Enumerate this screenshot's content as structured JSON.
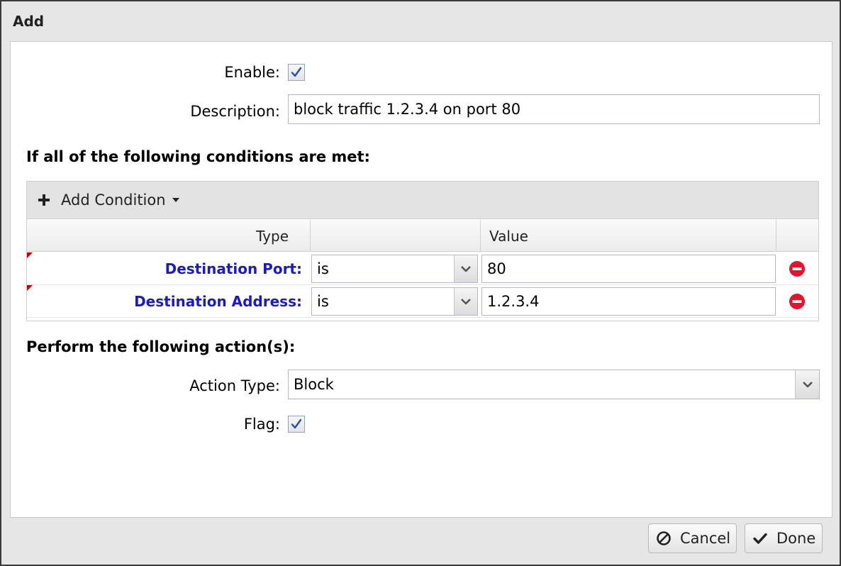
{
  "window": {
    "title": "Add"
  },
  "form": {
    "enable_label": "Enable:",
    "enable_checked": true,
    "description_label": "Description:",
    "description_value": "block traffic 1.2.3.4 on port 80"
  },
  "conditions": {
    "title": "If all of the following conditions are met:",
    "add_condition_label": "Add Condition",
    "columns": {
      "type": "Type",
      "operator": "",
      "value": "Value",
      "actions": ""
    },
    "rows": [
      {
        "type": "Destination Port:",
        "operator": "is",
        "value": "80"
      },
      {
        "type": "Destination Address:",
        "operator": "is",
        "value": "1.2.3.4"
      }
    ]
  },
  "actions": {
    "title": "Perform the following action(s):",
    "action_type_label": "Action Type:",
    "action_type_value": "Block",
    "flag_label": "Flag:",
    "flag_checked": true
  },
  "footer": {
    "cancel_label": "Cancel",
    "done_label": "Done"
  },
  "icons": {
    "add": "plus-icon",
    "dropdown": "caret-down-icon",
    "trigger": "chevron-down-icon",
    "remove": "remove-circle-icon",
    "cancel": "ban-icon",
    "done": "checkmark-icon"
  },
  "colors": {
    "condition_label": "#1a1acc",
    "remove_icon": "#e8102a",
    "dirty_marker": "#c00000",
    "chrome": "#e6e6e6"
  }
}
